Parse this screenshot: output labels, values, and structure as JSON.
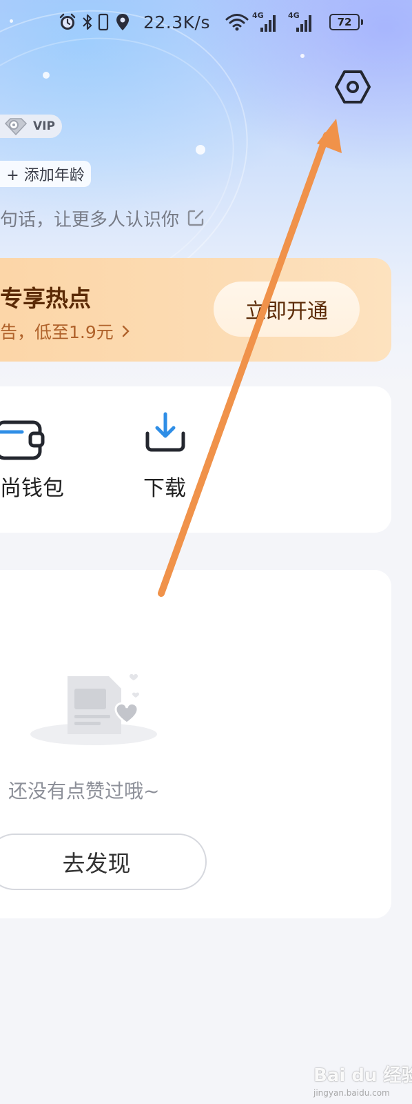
{
  "status_bar": {
    "network_speed": "22.3K/s",
    "net_type_1": "4G",
    "net_type_2": "4G",
    "battery": "72"
  },
  "profile": {
    "vip_label": "VIP",
    "add_age": "+ 添加年龄",
    "bio_placeholder": "句话，让更多人认识你"
  },
  "promo": {
    "title": "专享热点",
    "subtitle": "告，低至1.9元",
    "button": "立即开通"
  },
  "services": [
    {
      "label": "尚钱包",
      "icon": "wallet-icon"
    },
    {
      "label": "下载",
      "icon": "download-icon"
    }
  ],
  "likes": {
    "empty_text": "还没有点赞过哦~",
    "discover_button": "去发现"
  },
  "watermark": {
    "logo": "Bai du 经验",
    "sub": "jingyan.baidu.com"
  },
  "colors": {
    "promo_bg": "#fcd6a8",
    "promo_text": "#5b2a06",
    "download_icon": "#2f8ee6",
    "annotation_arrow": "#f0924a"
  }
}
